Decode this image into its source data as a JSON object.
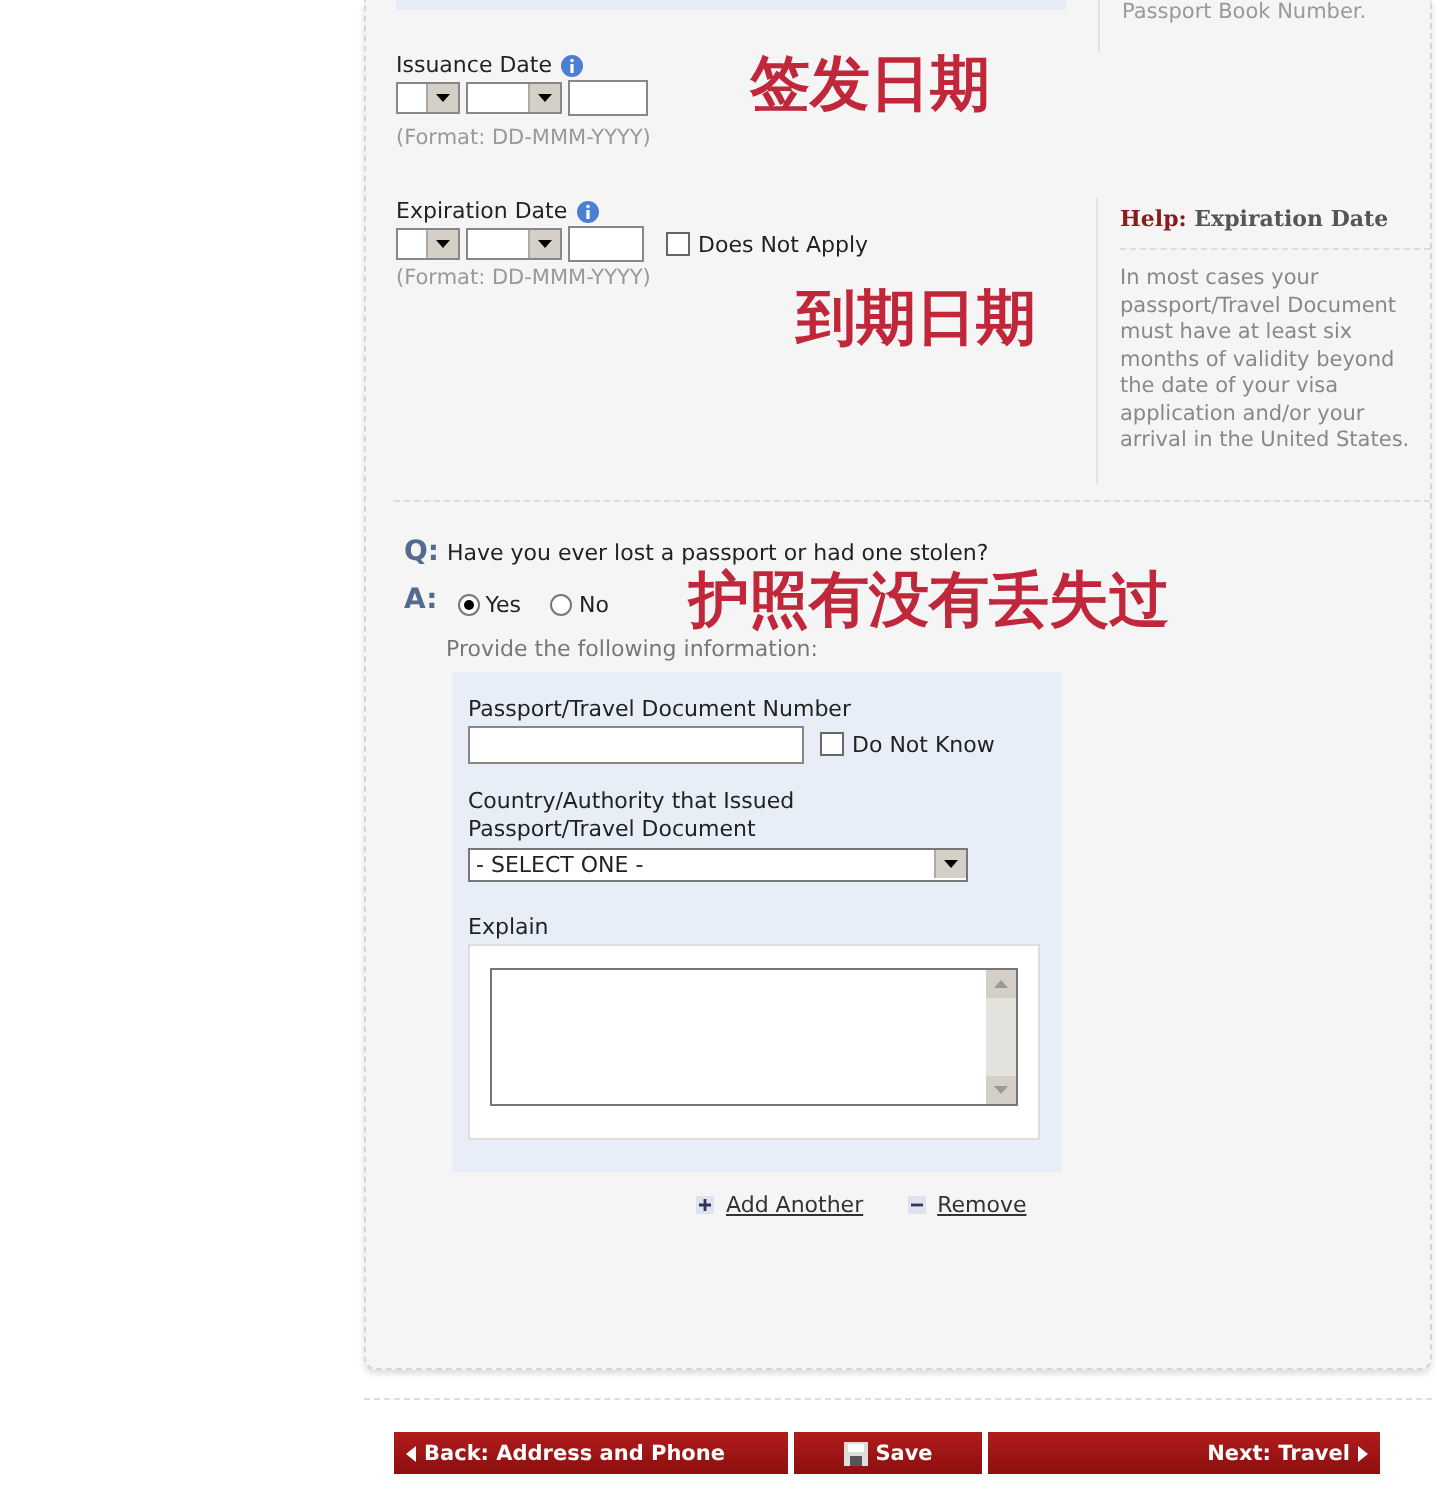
{
  "top_help": {
    "text": "Passport Book Number."
  },
  "issuance_date": {
    "label": "Issuance Date",
    "format": "(Format: DD-MMM-YYYY)",
    "annotation": "签发日期"
  },
  "expiration_date": {
    "label": "Expiration Date",
    "format": "(Format: DD-MMM-YYYY)",
    "does_not_apply": {
      "label": "Does Not Apply",
      "checked": false
    },
    "annotation": "到期日期"
  },
  "expiration_help": {
    "title_prefix": "Help:",
    "title": "Expiration Date",
    "text": "In most cases your passport/Travel Document must have at least six months of validity beyond the date of your visa application and/or your arrival in the United States."
  },
  "question": {
    "q_mark": "Q:",
    "text": "Have you ever lost a passport or had one stolen?",
    "a_mark": "A:",
    "options": [
      {
        "label": "Yes",
        "selected": true
      },
      {
        "label": "No",
        "selected": false
      }
    ],
    "annotation": "护照有没有丢失过"
  },
  "details": {
    "intro": "Provide the following information:",
    "number_label": "Passport/Travel Document Number",
    "do_not_know": {
      "label": "Do Not Know",
      "checked": false
    },
    "country_label": "Country/Authority that Issued Passport/Travel Document",
    "country_value": "- SELECT ONE -",
    "explain_label": "Explain"
  },
  "links": [
    {
      "kind": "add",
      "label": "Add Another"
    },
    {
      "kind": "remove",
      "label": "Remove"
    }
  ],
  "footer": [
    {
      "kind": "back",
      "label": "Back: Address and Phone"
    },
    {
      "kind": "save",
      "label": "Save"
    },
    {
      "kind": "next",
      "label": "Next: Travel"
    }
  ]
}
